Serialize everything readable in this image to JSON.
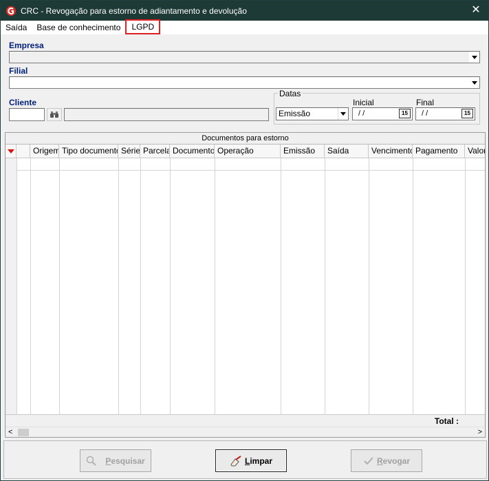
{
  "window": {
    "title": "CRC - Revogação para estorno de adiantamento e devolução",
    "close": "✕"
  },
  "menu": [
    "Saída",
    "Base de conhecimento",
    "LGPD"
  ],
  "form": {
    "empresa_label": "Empresa",
    "empresa_value": "",
    "filial_label": "Filial",
    "filial_value": "",
    "cliente_label": "Cliente",
    "cliente_code": "",
    "cliente_name": "",
    "datas_label": "Datas",
    "datas_type": "Emissão",
    "inicial_label": "Inicial",
    "inicial_value": " /  /",
    "final_label": "Final",
    "final_value": " /  /",
    "cal_icon_text": "15"
  },
  "grid": {
    "caption": "Documentos para estorno",
    "columns": [
      "Origem",
      "Tipo documento",
      "Série",
      "Parcela",
      "Documento",
      "Operação",
      "Emissão",
      "Saída",
      "Vencimento",
      "Pagamento",
      "Valor"
    ],
    "total_label": "Total :",
    "scroll_left": "<",
    "scroll_right": ">"
  },
  "buttons": {
    "pesquisar_first": "P",
    "pesquisar_rest": "esquisar",
    "limpar_first": "L",
    "limpar_rest": "impar",
    "revogar_first": "R",
    "revogar_rest": "evogar"
  },
  "colors": {
    "titlebar": "#1e3a36",
    "label_blue": "#001f7a",
    "highlight_red": "#e02020",
    "logo_red": "#d9302c"
  }
}
